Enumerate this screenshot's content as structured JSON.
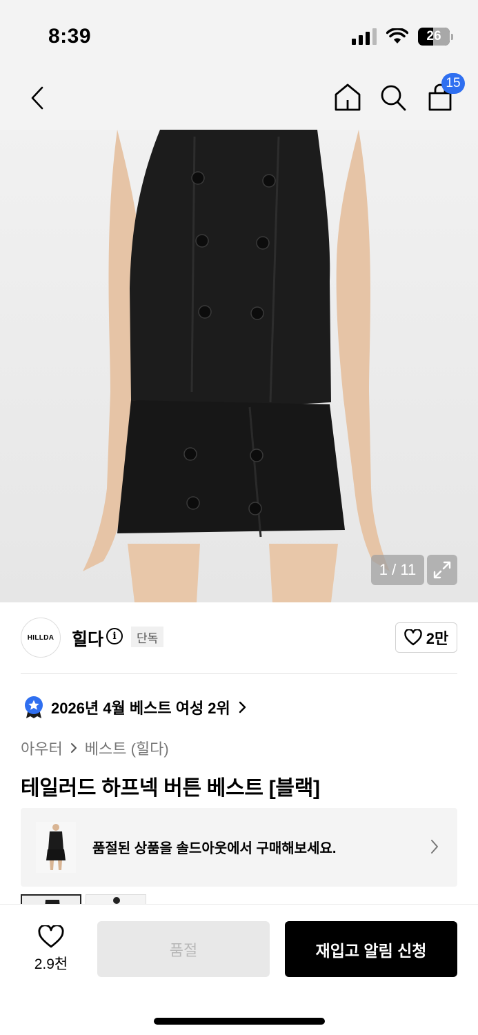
{
  "status_bar": {
    "time": "8:39",
    "battery": "26"
  },
  "nav": {
    "cart_count": "15"
  },
  "gallery": {
    "counter": "1 / 11"
  },
  "brand": {
    "logo_text": "HILLDA",
    "name": "힐다",
    "info_glyph": "i",
    "badge": "단독",
    "likes": "2만"
  },
  "ranking": {
    "text": "2026년 4월 베스트 여성 2위"
  },
  "breadcrumb": {
    "items": [
      "아우터",
      "베스트 (힐다)"
    ]
  },
  "product": {
    "title": "테일러드 하프넥 버튼 베스트 [블랙]"
  },
  "soldout_banner": {
    "text": "품절된 상품을 솔드아웃에서 구매해보세요."
  },
  "bottom_bar": {
    "wish_count": "2.9천",
    "soldout_label": "품절",
    "restock_label": "재입고 알림 신청"
  },
  "colors": {
    "accent": "#2f6ff0",
    "primary_button": "#000000",
    "disabled_button": "#e8e8e8"
  },
  "icons": [
    "back-icon",
    "home-icon",
    "search-icon",
    "cart-icon",
    "expand-icon",
    "info-icon",
    "heart-icon",
    "best-badge-icon",
    "chevron-right-icon"
  ]
}
